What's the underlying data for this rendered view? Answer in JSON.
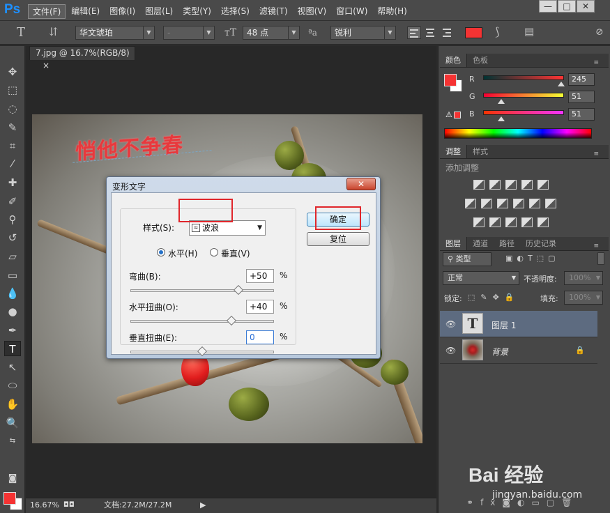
{
  "app": {
    "logo": "Ps"
  },
  "menu": [
    "文件(F)",
    "编辑(E)",
    "图像(I)",
    "图层(L)",
    "类型(Y)",
    "选择(S)",
    "滤镜(T)",
    "视图(V)",
    "窗口(W)",
    "帮助(H)"
  ],
  "window_controls": {
    "minimize": "—",
    "restore": "□",
    "close": "✕"
  },
  "options": {
    "font_family": "华文琥珀",
    "font_style": "-",
    "font_size": "48 点",
    "aa_label": "ªa",
    "antialias": "锐利",
    "text_color": "#f53333"
  },
  "document": {
    "tab_title": "7.jpg @ 16.7%(RGB/8)",
    "tab_close": "×",
    "canvas_text": "悄他不争春"
  },
  "status": {
    "zoom": "16.67%",
    "doc": "文档:27.2M/27.2M"
  },
  "color_panel": {
    "tabs": [
      "颜色",
      "色板"
    ],
    "r_label": "R",
    "r": "245",
    "g_label": "G",
    "g": "51",
    "b_label": "B",
    "b": "51",
    "fg": "#f53333",
    "bg": "#ffffff"
  },
  "adjust_panel": {
    "tabs": [
      "调整",
      "样式"
    ],
    "title": "添加调整"
  },
  "layers_panel": {
    "tabs": [
      "图层",
      "通道",
      "路径",
      "历史记录"
    ],
    "filter": "类型",
    "blend_mode": "正常",
    "opacity_label": "不透明度:",
    "opacity": "100%",
    "lock_label": "锁定:",
    "fill_label": "填充:",
    "fill": "100%",
    "layers": [
      {
        "name": "图层 1",
        "thumb": "T",
        "selected": true
      },
      {
        "name": "背景",
        "thumb": "",
        "locked": true
      }
    ]
  },
  "dialog": {
    "title": "变形文字",
    "close": "✕",
    "style_label": "样式(S):",
    "style_value": "波浪",
    "horizontal_label": "水平(H)",
    "vertical_label": "垂直(V)",
    "bend_label": "弯曲(B):",
    "bend": "+50",
    "h_distort_label": "水平扭曲(O):",
    "h_distort": "+40",
    "v_distort_label": "垂直扭曲(E):",
    "v_distort": "0",
    "percent": "%",
    "ok": "确定",
    "reset": "复位"
  },
  "watermark": {
    "brand": "Bai 经验",
    "url": "jingyan.baidu.com"
  }
}
